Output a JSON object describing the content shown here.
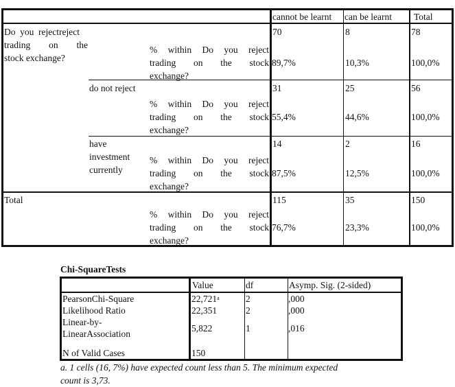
{
  "crosstab": {
    "column_headers": [
      "cannot be learnt",
      "can be learnt",
      "Total"
    ],
    "row_variable_label": "Do you reject trading on the stock exchange?",
    "row_variable_first_line": "Do you reject",
    "row_variable_second_line": "trading on the",
    "row_variable_third_line": "stock exchange?",
    "stat_label_line1": "% within Do you reject",
    "stat_label_line2": "trading on the stock",
    "stat_label_line3": "exchange?",
    "rows": [
      {
        "category": "reject",
        "category_lines": [
          "reject"
        ],
        "counts": [
          "70",
          "8",
          "78"
        ],
        "percents": [
          "89,7%",
          "10,3%",
          "100,0%"
        ]
      },
      {
        "category": "do not reject",
        "category_lines": [
          "do not reject"
        ],
        "counts": [
          "31",
          "25",
          "56"
        ],
        "percents": [
          "55,4%",
          "44,6%",
          "100,0%"
        ]
      },
      {
        "category": "have investment currently",
        "category_lines": [
          "have",
          "investment",
          "currently"
        ],
        "counts": [
          "14",
          "2",
          "16"
        ],
        "percents": [
          "87,5%",
          "12,5%",
          "100,0%"
        ]
      }
    ],
    "total_row": {
      "label": "Total",
      "counts": [
        "115",
        "35",
        "150"
      ],
      "percents": [
        "76,7%",
        "23,3%",
        "100,0%"
      ]
    }
  },
  "chi_square": {
    "title": "Chi-SquareTests",
    "headers": [
      "",
      "Value",
      "df",
      "Asymp. Sig. (2-sided)"
    ],
    "rows": [
      {
        "label_lines": [
          "PearsonChi-Square"
        ],
        "value": "22,721",
        "value_sup": "a",
        "df": "2",
        "sig": ",000"
      },
      {
        "label_lines": [
          "Likelihood Ratio"
        ],
        "value": "22,351",
        "value_sup": "",
        "df": "2",
        "sig": ",000"
      },
      {
        "label_lines": [
          "Linear-by-",
          "LinearAssociation"
        ],
        "value": "5,822",
        "value_sup": "",
        "df": "1",
        "sig": ",016"
      },
      {
        "label_lines": [
          "N of Valid Cases"
        ],
        "value": "150",
        "value_sup": "",
        "df": "",
        "sig": ""
      }
    ],
    "footnote_line1": "a. 1 cells (16, 7%) have expected count less than 5. The minimum expected",
    "footnote_line2": "count is 3,73."
  }
}
